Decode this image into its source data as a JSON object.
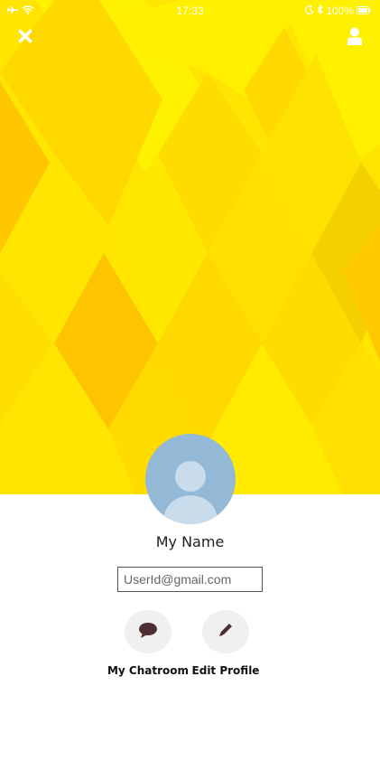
{
  "status_bar": {
    "time": "17:33",
    "battery": "100%",
    "icons_left": [
      "airplane-icon",
      "wifi-icon"
    ],
    "icons_right": [
      "moon-icon",
      "bluetooth-icon",
      "battery-icon"
    ]
  },
  "header": {
    "close_icon": "close-icon",
    "profile_icon": "user-icon"
  },
  "colors": {
    "hero_base": "#ffe500",
    "hero_light": "#fff200",
    "hero_dark": "#ffc800",
    "avatar_bg": "#93b9d7",
    "avatar_fg": "#c9dceb",
    "action_bg": "#f0f0f0",
    "icon_dark": "#4e2f2f"
  },
  "profile": {
    "name": "My Name",
    "email_placeholder": "UserId@gmail.com"
  },
  "actions": [
    {
      "label": "My Chatroom",
      "icon": "chat-bubble-icon"
    },
    {
      "label": "Edit Profile",
      "icon": "pencil-icon"
    }
  ]
}
